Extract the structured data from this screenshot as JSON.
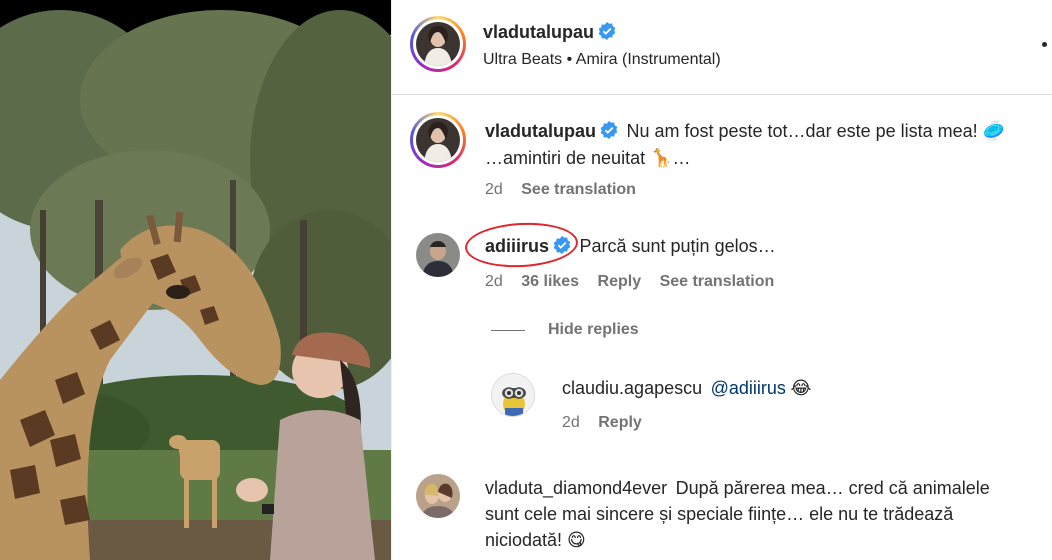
{
  "post": {
    "author": "vladutalupau",
    "audio_artist": "Ultra Beats",
    "audio_separator": "•",
    "audio_track": "Amira (Instrumental)"
  },
  "caption": {
    "author": "vladutalupau",
    "text_line1": "Nu am fost peste tot…dar este pe lista mea! 🥏",
    "text_line2": "…amintiri de neuitat 🦒…",
    "age": "2d",
    "see_translation": "See translation"
  },
  "comments": [
    {
      "author": "adiiirus",
      "verified": true,
      "text": "Parcă sunt puțin gelos…",
      "age": "2d",
      "likes": "36 likes",
      "reply": "Reply",
      "see_translation": "See translation",
      "hide_replies": "Hide replies",
      "replies": [
        {
          "author": "claudiu.agapescu",
          "mention": "@adiiirus",
          "emoji": "😂",
          "age": "2d",
          "reply": "Reply"
        }
      ]
    },
    {
      "author": "vladuta_diamond4ever",
      "text_line1": "După părerea mea… cred că animalele",
      "text_line2": "sunt cele mai sincere și speciale ființe… ele nu te trădează",
      "text_line3": "niciodată! 😋"
    }
  ],
  "colors": {
    "verified_badge": "#3897f0",
    "annotation_circle": "#e0252c",
    "secondary_text": "#737373",
    "link_text": "#00376b"
  },
  "icons": {
    "verified": "verified-badge-icon",
    "more": "more-options-icon"
  }
}
